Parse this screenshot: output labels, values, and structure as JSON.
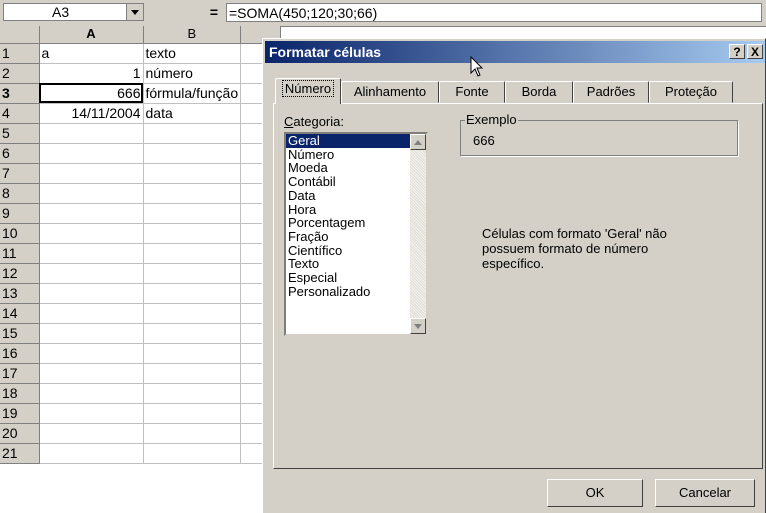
{
  "formula_bar": {
    "name_box": "A3",
    "equals_label": "=",
    "formula": "=SOMA(450;120;30;66)"
  },
  "grid": {
    "columns": [
      "A",
      "B"
    ],
    "active_cell": "A3",
    "rows": [
      {
        "n": "1",
        "a": "a",
        "b": "texto"
      },
      {
        "n": "2",
        "a": "1",
        "b": "número"
      },
      {
        "n": "3",
        "a": "666",
        "b": "fórmula/função"
      },
      {
        "n": "4",
        "a": "14/11/2004",
        "b": "data"
      },
      {
        "n": "5",
        "a": "",
        "b": ""
      },
      {
        "n": "6",
        "a": "",
        "b": ""
      },
      {
        "n": "7",
        "a": "",
        "b": ""
      },
      {
        "n": "8",
        "a": "",
        "b": ""
      },
      {
        "n": "9",
        "a": "",
        "b": ""
      },
      {
        "n": "10",
        "a": "",
        "b": ""
      },
      {
        "n": "11",
        "a": "",
        "b": ""
      },
      {
        "n": "12",
        "a": "",
        "b": ""
      },
      {
        "n": "13",
        "a": "",
        "b": ""
      },
      {
        "n": "14",
        "a": "",
        "b": ""
      },
      {
        "n": "15",
        "a": "",
        "b": ""
      },
      {
        "n": "16",
        "a": "",
        "b": ""
      },
      {
        "n": "17",
        "a": "",
        "b": ""
      },
      {
        "n": "18",
        "a": "",
        "b": ""
      },
      {
        "n": "19",
        "a": "",
        "b": ""
      },
      {
        "n": "20",
        "a": "",
        "b": ""
      },
      {
        "n": "21",
        "a": "",
        "b": ""
      }
    ]
  },
  "dialog": {
    "title": "Formatar células",
    "help_label": "?",
    "close_label": "X",
    "tabs": [
      "Número",
      "Alinhamento",
      "Fonte",
      "Borda",
      "Padrões",
      "Proteção"
    ],
    "active_tab": "Número",
    "category_label_first": "C",
    "category_label_rest": "ategoria:",
    "categories": [
      "Geral",
      "Número",
      "Moeda",
      "Contábil",
      "Data",
      "Hora",
      "Porcentagem",
      "Fração",
      "Científico",
      "Texto",
      "Especial",
      "Personalizado"
    ],
    "selected_category": "Geral",
    "example_label": "Exemplo",
    "example_value": "666",
    "description": "Células com formato 'Geral' não possuem formato de número específico.",
    "ok_label": "OK",
    "cancel_label": "Cancelar"
  },
  "colors": {
    "title_bar_start": "#0a246a",
    "title_bar_end": "#a6caf0",
    "face": "#d4d0c8",
    "selection": "#0a246a"
  },
  "icons": [
    "dropdown-arrow-icon",
    "scroll-up-arrow-icon",
    "scroll-down-arrow-icon",
    "mouse-pointer-icon"
  ]
}
